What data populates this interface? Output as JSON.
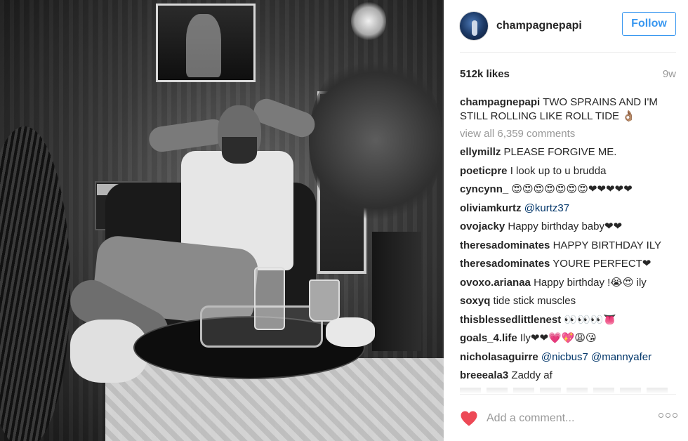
{
  "post": {
    "image_alt": "black and white photo of a man relaxing in a chair with a foot wrap",
    "account": {
      "username": "champagnepapi",
      "follow_label": "Follow"
    },
    "likes_label": "512k likes",
    "time_ago": "9w",
    "caption": {
      "author": "champagnepapi",
      "text": " TWO SPRAINS AND I'M STILL ROLLING LIKE ROLL TIDE 👌🏽"
    },
    "view_all_label": "view all 6,359 comments",
    "comments": [
      {
        "author": "ellymillz",
        "text": "PLEASE FORGIVE ME."
      },
      {
        "author": "poeticpre",
        "text": "I look up to u brudda"
      },
      {
        "author": "cyncynn_",
        "text": "😍😍😍😍😍😍😍❤❤❤❤❤"
      },
      {
        "author": "oliviamkurtz",
        "mention": "@kurtz37"
      },
      {
        "author": "ovojacky",
        "text": "Happy birthday baby❤❤"
      },
      {
        "author": "theresadominates",
        "text": "HAPPY BIRTHDAY ILY"
      },
      {
        "author": "theresadominates",
        "text": "YOURE PERFECT❤"
      },
      {
        "author": "ovoxo.arianaa",
        "text": "Happy birthday !😭😍 ily"
      },
      {
        "author": "soxyq",
        "text": "tide stick muscles"
      },
      {
        "author": "thisblessedlittlenest",
        "text": "👀👀👀👅"
      },
      {
        "author": "goals_4.life",
        "text": "Ily❤❤💗💖😩😘"
      },
      {
        "author": "nicholasaguirre",
        "mention": "@nicbus7",
        "mention2": "@mannyafer"
      },
      {
        "author": "breeeala3",
        "text": "Zaddy af"
      }
    ],
    "add_comment_placeholder": "Add a comment...",
    "icons": {
      "like": "heart-icon",
      "options": "more-options-icon"
    },
    "colors": {
      "accent": "#3897f0",
      "heart": "#ed4956",
      "mention": "#003569",
      "muted": "#999999"
    }
  }
}
